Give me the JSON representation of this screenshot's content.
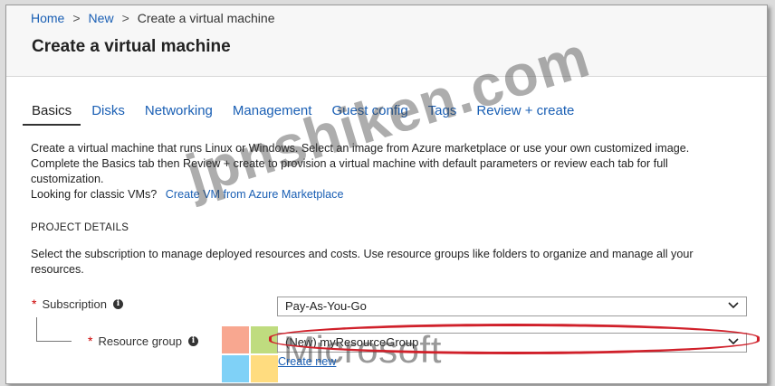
{
  "breadcrumb": {
    "home": "Home",
    "new": "New",
    "current": "Create a virtual machine",
    "separator": ">"
  },
  "page": {
    "title": "Create a virtual machine"
  },
  "tabs": [
    {
      "label": "Basics",
      "active": true
    },
    {
      "label": "Disks"
    },
    {
      "label": "Networking"
    },
    {
      "label": "Management"
    },
    {
      "label": "Guest config"
    },
    {
      "label": "Tags"
    },
    {
      "label": "Review + create"
    }
  ],
  "description": {
    "line1": "Create a virtual machine that runs Linux or Windows. Select an image from Azure marketplace or use your own customized image.",
    "line2": "Complete the Basics tab then Review + create to provision a virtual machine with default parameters or review each tab for full",
    "line3": "customization.",
    "classic_prefix": "Looking for classic VMs?",
    "classic_link": "Create VM from Azure Marketplace"
  },
  "project": {
    "title": "PROJECT DETAILS",
    "desc_line1": "Select the subscription to manage deployed resources and costs. Use resource groups like folders to organize and manage all your",
    "desc_line2": "resources."
  },
  "subscription": {
    "required": "*",
    "label": "Subscription",
    "value": "Pay-As-You-Go"
  },
  "resource_group": {
    "required": "*",
    "label": "Resource group",
    "value": "(New) myResourceGroup",
    "create_new": "Create new"
  },
  "overlay": {
    "watermark": "jpnshiken.com",
    "ms_word": "Microsoft"
  },
  "colors": {
    "link": "#1a5fb4",
    "required": "#cc0000",
    "highlight": "#d0202a",
    "ms_red": "#f25022",
    "ms_green": "#7fba00",
    "ms_blue": "#00a4ef",
    "ms_yellow": "#ffb900"
  },
  "icons": {
    "info": "info-icon",
    "chevron": "chevron-down-icon"
  }
}
